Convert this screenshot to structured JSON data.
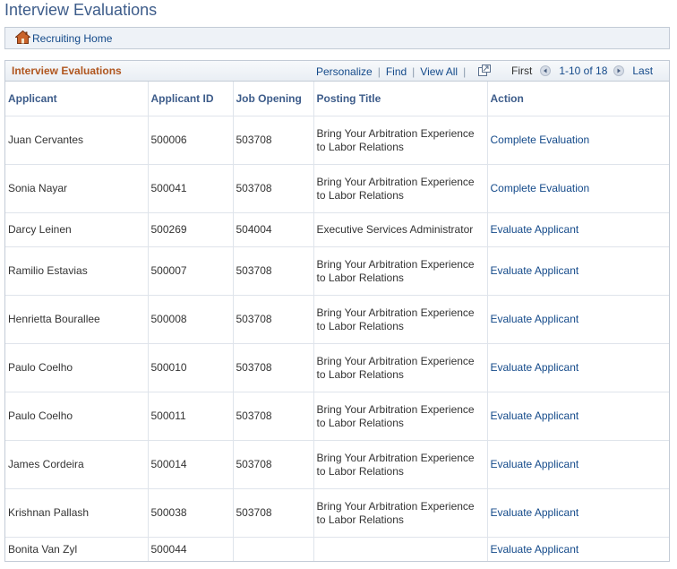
{
  "page": {
    "title": "Interview Evaluations"
  },
  "breadcrumb": {
    "home_label": "Recruiting Home"
  },
  "grid": {
    "title": "Interview Evaluations",
    "tools": {
      "personalize": "Personalize",
      "find": "Find",
      "view_all": "View All",
      "separator": "|"
    },
    "pager": {
      "first": "First",
      "count": "1-10 of 18",
      "last": "Last"
    },
    "columns": [
      "Applicant",
      "Applicant ID",
      "Job Opening",
      "Posting Title",
      "Action"
    ],
    "rows": [
      {
        "applicant": "Juan Cervantes",
        "id": "500006",
        "job": "503708",
        "title": "Bring Your Arbitration Experience to Labor Relations",
        "action": "Complete Evaluation"
      },
      {
        "applicant": "Sonia Nayar",
        "id": "500041",
        "job": "503708",
        "title": "Bring Your Arbitration Experience to Labor Relations",
        "action": "Complete Evaluation"
      },
      {
        "applicant": "Darcy Leinen",
        "id": "500269",
        "job": "504004",
        "title": "Executive Services Administrator",
        "action": "Evaluate Applicant"
      },
      {
        "applicant": "Ramilio Estavias",
        "id": "500007",
        "job": "503708",
        "title": "Bring Your Arbitration Experience to Labor Relations",
        "action": "Evaluate Applicant"
      },
      {
        "applicant": "Henrietta Bourallee",
        "id": "500008",
        "job": "503708",
        "title": "Bring Your Arbitration Experience to Labor Relations",
        "action": "Evaluate Applicant"
      },
      {
        "applicant": "Paulo Coelho",
        "id": "500010",
        "job": "503708",
        "title": "Bring Your Arbitration Experience to Labor Relations",
        "action": "Evaluate Applicant"
      },
      {
        "applicant": "Paulo Coelho",
        "id": "500011",
        "job": "503708",
        "title": "Bring Your Arbitration Experience to Labor Relations",
        "action": "Evaluate Applicant"
      },
      {
        "applicant": "James Cordeira",
        "id": "500014",
        "job": "503708",
        "title": "Bring Your Arbitration Experience to Labor Relations",
        "action": "Evaluate Applicant"
      },
      {
        "applicant": "Krishnan Pallash",
        "id": "500038",
        "job": "503708",
        "title": "Bring Your Arbitration Experience to Labor Relations",
        "action": "Evaluate Applicant"
      },
      {
        "applicant": "Bonita Van Zyl",
        "id": "500044",
        "job": "",
        "title": "",
        "action": "Evaluate Applicant"
      }
    ]
  },
  "colors": {
    "title": "#3d5c8a",
    "grid_title": "#b0561f",
    "link": "#144a8a",
    "border": "#c3cbd6"
  },
  "icons": {
    "home": "home-icon",
    "popout": "popout-icon",
    "prev": "arrow-left-icon",
    "next": "arrow-right-icon"
  }
}
